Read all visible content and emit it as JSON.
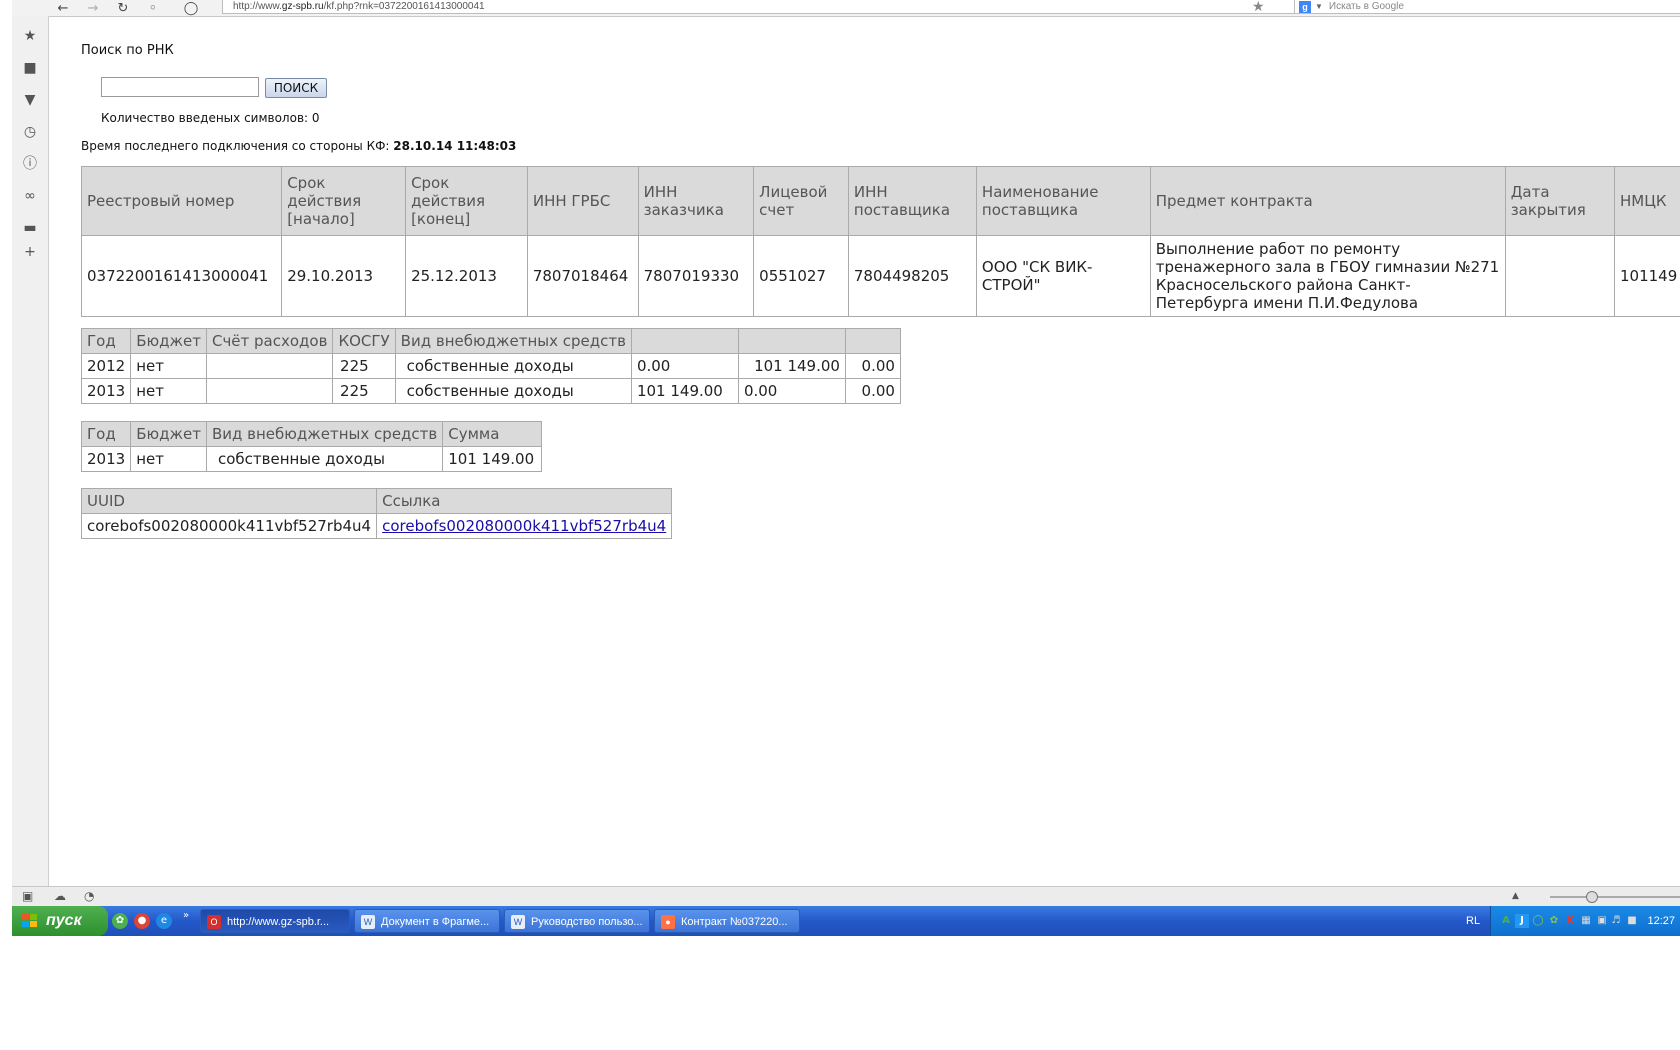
{
  "browser": {
    "url_prefix": "http://www.",
    "url_domain": "gz-spb.ru",
    "url_rest": "/kf.php?rnk=0372200161413000041",
    "search_placeholder": "Искать в Google"
  },
  "page": {
    "title": "Поиск по РНК",
    "search_button": "ПОИСК",
    "char_count_text": "Количество введеных символов: 0",
    "last_connection_label": "Время последнего подключения со стороны КФ:",
    "last_connection_value": "28.10.14 11:48:03"
  },
  "main_table": {
    "headers": [
      "Реестровый номер",
      "Срок действия [начало]",
      "Срок действия [конец]",
      "ИНН ГРБС",
      "ИНН заказчика",
      "Лицевой счет",
      "ИНН поставщика",
      "Наименование поставщика",
      "Предмет контракта",
      "Дата закрытия",
      "НМЦК"
    ],
    "row": [
      "0372200161413000041",
      "29.10.2013",
      "25.12.2013",
      "7807018464",
      "7807019330",
      "0551027",
      "7804498205",
      "ООО \"СК ВИК-СТРОЙ\"",
      "Выполнение работ по ремонту тренажерного зала в ГБОУ гимназии №271 Красносельского района Санкт-Петербурга имени П.И.Федулова",
      "",
      "101149"
    ]
  },
  "budget_table": {
    "headers": [
      "Год",
      "Бюджет",
      "Счёт расходов",
      "КОСГУ",
      "Вид внебюджетных средств",
      "",
      "",
      ""
    ],
    "rows": [
      [
        "2012",
        "нет",
        "",
        "225",
        "собственные доходы",
        "0.00",
        "101 149.00",
        "0.00"
      ],
      [
        "2013",
        "нет",
        "",
        "225",
        "собственные доходы",
        "101 149.00",
        "0.00",
        "0.00"
      ]
    ]
  },
  "sum_table": {
    "headers": [
      "Год",
      "Бюджет",
      "Вид внебюджетных средств",
      "Сумма"
    ],
    "row": [
      "2013",
      "нет",
      "собственные доходы",
      "101 149.00"
    ]
  },
  "uuid_table": {
    "headers": [
      "UUID",
      "Ссылка"
    ],
    "row": [
      "corebofs002080000k411vbf527rb4u4",
      "corebofs002080000k411vbf527rb4u4"
    ]
  },
  "taskbar": {
    "start_label": "пуск",
    "tasks": [
      "http://www.gz-spb.r...",
      "Документ в Фрагме...",
      "Руководство пользо...",
      "Контракт №037220..."
    ],
    "lang": "RL",
    "clock": "12:27"
  }
}
